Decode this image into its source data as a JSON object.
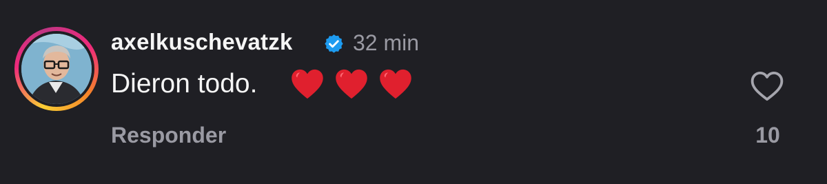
{
  "comment": {
    "username": "axelkuschevatzk",
    "verified": true,
    "time": "32 min",
    "text": "Dieron todo.",
    "emojis": [
      "red-heart",
      "red-heart",
      "red-heart"
    ],
    "reply_label": "Responder",
    "like_count": "10"
  },
  "colors": {
    "background": "#1f1f24",
    "primary_text": "#f5f5f5",
    "secondary_text": "#9a9aa3",
    "verified_blue": "#1d9bf0",
    "heart_red": "#e0202e"
  }
}
